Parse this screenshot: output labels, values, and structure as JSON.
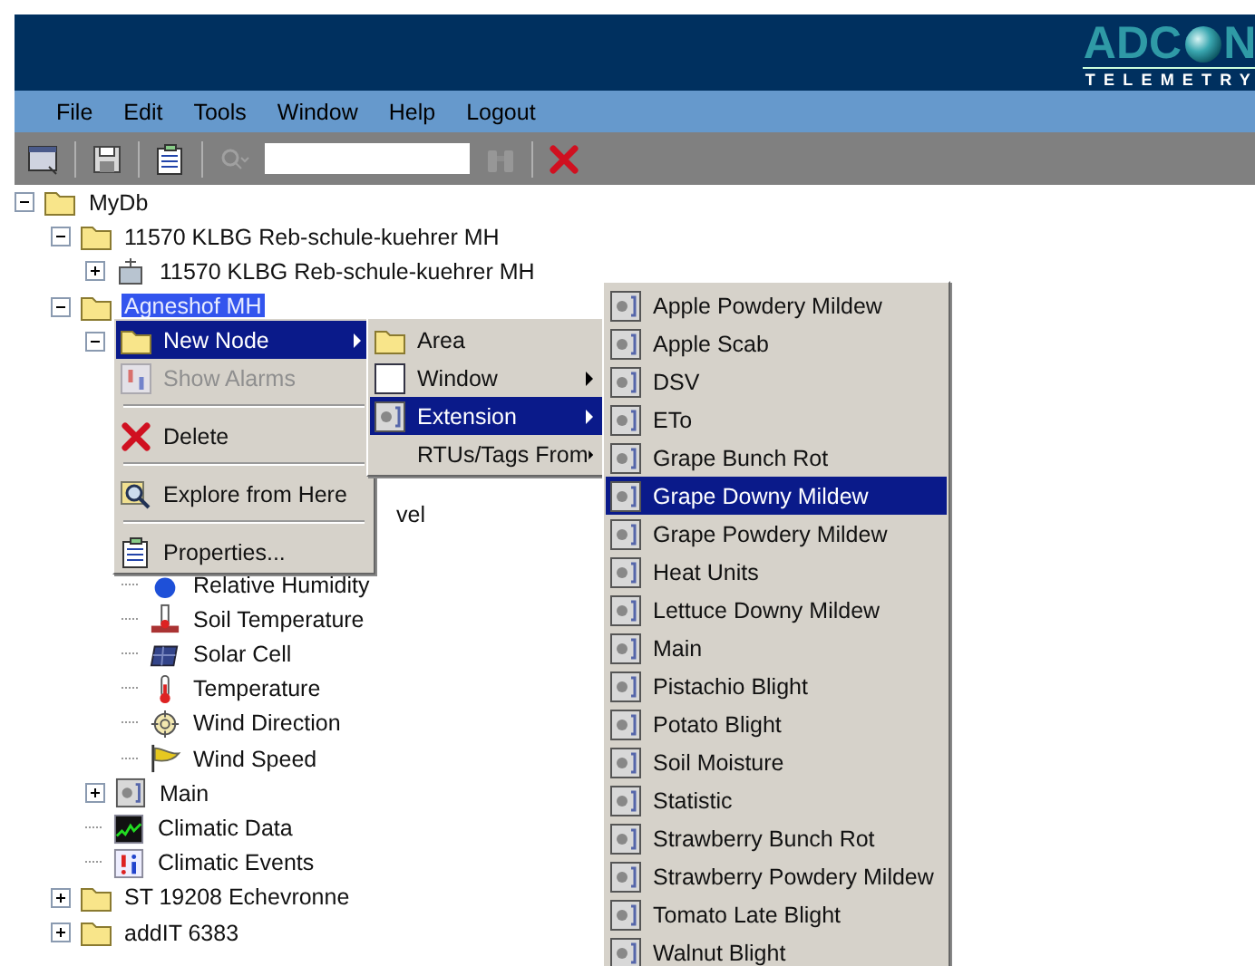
{
  "header": {
    "logo_left": "ADC",
    "logo_right": "N",
    "tagline": "TELEMETRY"
  },
  "menu_bar": [
    {
      "label": "File"
    },
    {
      "label": "Edit"
    },
    {
      "label": "Tools"
    },
    {
      "label": "Window"
    },
    {
      "label": "Help"
    },
    {
      "label": "Logout"
    }
  ],
  "toolbar": [
    {
      "kind": "window"
    },
    {
      "kind": "separator"
    },
    {
      "kind": "save"
    },
    {
      "kind": "separator"
    },
    {
      "kind": "properties"
    },
    {
      "kind": "separator"
    },
    {
      "kind": "find",
      "disabled": true
    },
    {
      "kind": "field"
    },
    {
      "kind": "binoculars",
      "disabled": true
    },
    {
      "kind": "separator"
    },
    {
      "kind": "delete"
    }
  ],
  "tree": [
    {
      "label": "MyDb",
      "kind": "folder",
      "expanded": true,
      "selected": false,
      "children": [
        {
          "label": "11570 KLBG Reb-schule-kuehrer MH",
          "kind": "folder",
          "expanded": true,
          "selected": false,
          "children": [
            {
              "label": "11570 KLBG Reb-schule-kuehrer MH",
              "kind": "station",
              "expanded": false,
              "selected": false
            }
          ]
        },
        {
          "label": "Agneshof MH",
          "kind": "folder",
          "expanded": true,
          "selected": true,
          "children": [
            {
              "kind": "station",
              "expanded": true,
              "children": [
                {
                  "label": "vel",
                  "kind": "partial",
                  "selected": false
                },
                {
                  "label": "Relative Humidity",
                  "kind": "humidity",
                  "selected": false
                },
                {
                  "label": "Soil Temperature",
                  "kind": "soil-temp",
                  "selected": false
                },
                {
                  "label": "Solar Cell",
                  "kind": "solar",
                  "selected": false
                },
                {
                  "label": "Temperature",
                  "kind": "thermometer",
                  "selected": false
                },
                {
                  "label": "Wind Direction",
                  "kind": "wind-direction",
                  "selected": false
                },
                {
                  "label": "Wind Speed",
                  "kind": "wind-speed",
                  "selected": false
                }
              ]
            },
            {
              "label": "Main",
              "kind": "extension",
              "expanded": false,
              "selected": false
            },
            {
              "label": "Climatic Data",
              "kind": "chart",
              "selected": false
            },
            {
              "label": "Climatic Events",
              "kind": "events",
              "selected": false
            }
          ]
        },
        {
          "label": "ST 19208 Echevronne",
          "kind": "folder",
          "expanded": false,
          "selected": false
        },
        {
          "label": "addIT 6383",
          "kind": "folder",
          "expanded": false,
          "selected": false
        }
      ]
    }
  ],
  "context_menu": [
    {
      "kind": "folder",
      "label": "New Node",
      "submenu": true,
      "selected": true,
      "disabled": false
    },
    {
      "kind": "events",
      "label": "Show Alarms",
      "submenu": false,
      "selected": false,
      "disabled": true
    },
    {
      "kind": "separator"
    },
    {
      "kind": "delete",
      "label": "Delete",
      "submenu": false,
      "selected": false,
      "disabled": false
    },
    {
      "kind": "separator"
    },
    {
      "kind": "explore",
      "label": "Explore from Here",
      "submenu": false,
      "selected": false,
      "disabled": false
    },
    {
      "kind": "separator"
    },
    {
      "kind": "properties",
      "label": "Properties...",
      "submenu": false,
      "selected": false,
      "disabled": false
    }
  ],
  "submenu": [
    {
      "label": "Area",
      "kind": "folder",
      "submenu": false,
      "selected": false
    },
    {
      "label": "Window",
      "kind": "window",
      "submenu": true,
      "selected": false
    },
    {
      "label": "Extension",
      "kind": "extension",
      "submenu": true,
      "selected": true
    },
    {
      "label": "RTUs/Tags From",
      "kind": "plain",
      "submenu": true,
      "selected": false
    }
  ],
  "extension_menu": [
    {
      "label": "Apple Powdery Mildew",
      "selected": false
    },
    {
      "label": "Apple Scab",
      "selected": false
    },
    {
      "label": "DSV",
      "selected": false
    },
    {
      "label": "ETo",
      "selected": false
    },
    {
      "label": "Grape Bunch Rot",
      "selected": false
    },
    {
      "label": "Grape Downy Mildew",
      "selected": true
    },
    {
      "label": "Grape Powdery Mildew",
      "selected": false
    },
    {
      "label": "Heat Units",
      "selected": false
    },
    {
      "label": "Lettuce Downy Mildew",
      "selected": false
    },
    {
      "label": "Main",
      "selected": false
    },
    {
      "label": "Pistachio Blight",
      "selected": false
    },
    {
      "label": "Potato Blight",
      "selected": false
    },
    {
      "label": "Soil Moisture",
      "selected": false
    },
    {
      "label": "Statistic",
      "selected": false
    },
    {
      "label": "Strawberry Bunch Rot",
      "selected": false
    },
    {
      "label": "Strawberry Powdery Mildew",
      "selected": false
    },
    {
      "label": "Tomato Late Blight",
      "selected": false
    },
    {
      "label": "Walnut Blight",
      "selected": false
    }
  ]
}
